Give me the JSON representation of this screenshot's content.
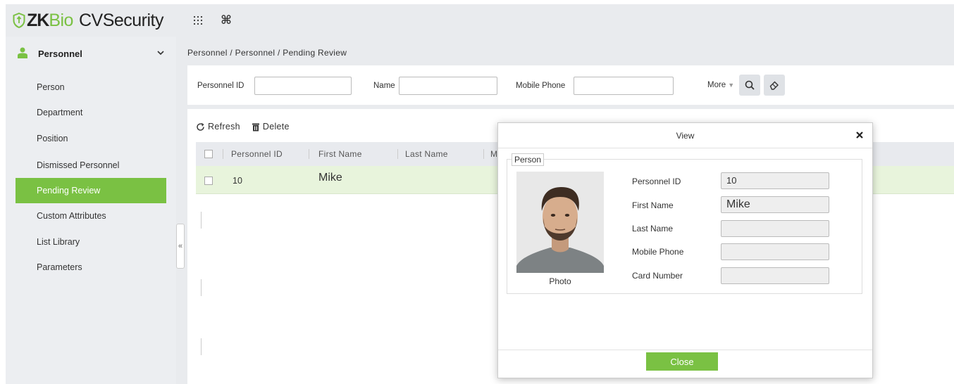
{
  "brand": {
    "zk": "ZK",
    "bio": "Bio",
    "product": "CVSecurity"
  },
  "topbar": {
    "apps_icon": "grid-dots-icon",
    "command_icon": "command-icon"
  },
  "sidebar": {
    "module": "Personnel",
    "items": [
      {
        "label": "Person"
      },
      {
        "label": "Department"
      },
      {
        "label": "Position"
      },
      {
        "label": "Dismissed Personnel"
      },
      {
        "label": "Pending Review",
        "active": true
      },
      {
        "label": "Custom Attributes"
      },
      {
        "label": "List Library"
      },
      {
        "label": "Parameters"
      }
    ]
  },
  "breadcrumb": "Personnel / Personnel / Pending Review",
  "search": {
    "personnel_id_label": "Personnel ID",
    "name_label": "Name",
    "mobile_label": "Mobile Phone",
    "more_label": "More",
    "personnel_id_value": "",
    "name_value": "",
    "mobile_value": ""
  },
  "toolbar": {
    "refresh": "Refresh",
    "delete": "Delete"
  },
  "grid": {
    "columns": [
      "Personnel ID",
      "First Name",
      "Last Name",
      "M"
    ],
    "rows": [
      {
        "personnel_id": "10",
        "first_name": "Mike"
      }
    ]
  },
  "dialog": {
    "title": "View",
    "legend": "Person",
    "photo_label": "Photo",
    "fields": [
      {
        "label": "Personnel ID",
        "value": "10"
      },
      {
        "label": "First Name",
        "value": "Mike"
      },
      {
        "label": "Last Name",
        "value": ""
      },
      {
        "label": "Mobile Phone",
        "value": ""
      },
      {
        "label": "Card Number",
        "value": ""
      }
    ],
    "close": "Close"
  },
  "colors": {
    "accent": "#7ac143",
    "sidebar_bg": "#eceef1",
    "row_selected": "#e8f4dc"
  }
}
